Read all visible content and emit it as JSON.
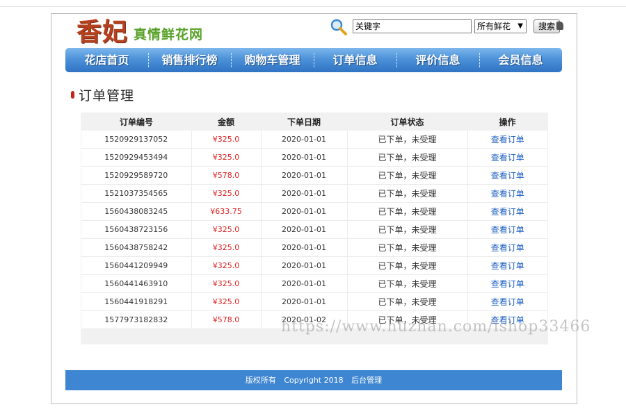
{
  "logo": {
    "name": "香妃",
    "tagline": "真情鲜花网"
  },
  "search": {
    "value": "关键字",
    "category": "所有鲜花",
    "button": "搜索"
  },
  "nav": [
    "花店首页",
    "销售排行榜",
    "购物车管理",
    "订单信息",
    "评价信息",
    "会员信息"
  ],
  "section_title": "订单管理",
  "table": {
    "headers": [
      "订单编号",
      "金额",
      "下单日期",
      "订单状态",
      "操作"
    ],
    "rows": [
      [
        "1520929137052",
        "¥325.0",
        "2020-01-01",
        "已下单，未受理",
        "查看订单"
      ],
      [
        "1520929453494",
        "¥325.0",
        "2020-01-01",
        "已下单，未受理",
        "查看订单"
      ],
      [
        "1520929589720",
        "¥578.0",
        "2020-01-01",
        "已下单，未受理",
        "查看订单"
      ],
      [
        "1521037354565",
        "¥325.0",
        "2020-01-01",
        "已下单，未受理",
        "查看订单"
      ],
      [
        "1560438083245",
        "¥633.75",
        "2020-01-01",
        "已下单，未受理",
        "查看订单"
      ],
      [
        "1560438723156",
        "¥325.0",
        "2020-01-01",
        "已下单，未受理",
        "查看订单"
      ],
      [
        "1560438758242",
        "¥325.0",
        "2020-01-01",
        "已下单，未受理",
        "查看订单"
      ],
      [
        "1560441209949",
        "¥325.0",
        "2020-01-01",
        "已下单，未受理",
        "查看订单"
      ],
      [
        "1560441463910",
        "¥325.0",
        "2020-01-01",
        "已下单，未受理",
        "查看订单"
      ],
      [
        "1560441918291",
        "¥325.0",
        "2020-01-01",
        "已下单，未受理",
        "查看订单"
      ],
      [
        "1577973182832",
        "¥578.0",
        "2020-01-02",
        "已下单，未受理",
        "查看订单"
      ]
    ]
  },
  "watermark": "https://www.huzhan.com/ishop33466",
  "footer": {
    "rights": "版权所有",
    "copyright": "Copyright 2018",
    "admin": "后台管理"
  },
  "colors": {
    "nav": "#4d92d9",
    "footer": "#3f86d2",
    "amount": "#e02020",
    "link": "#1d5fc2",
    "logo": "#b5411f",
    "tagline": "#58a128"
  }
}
